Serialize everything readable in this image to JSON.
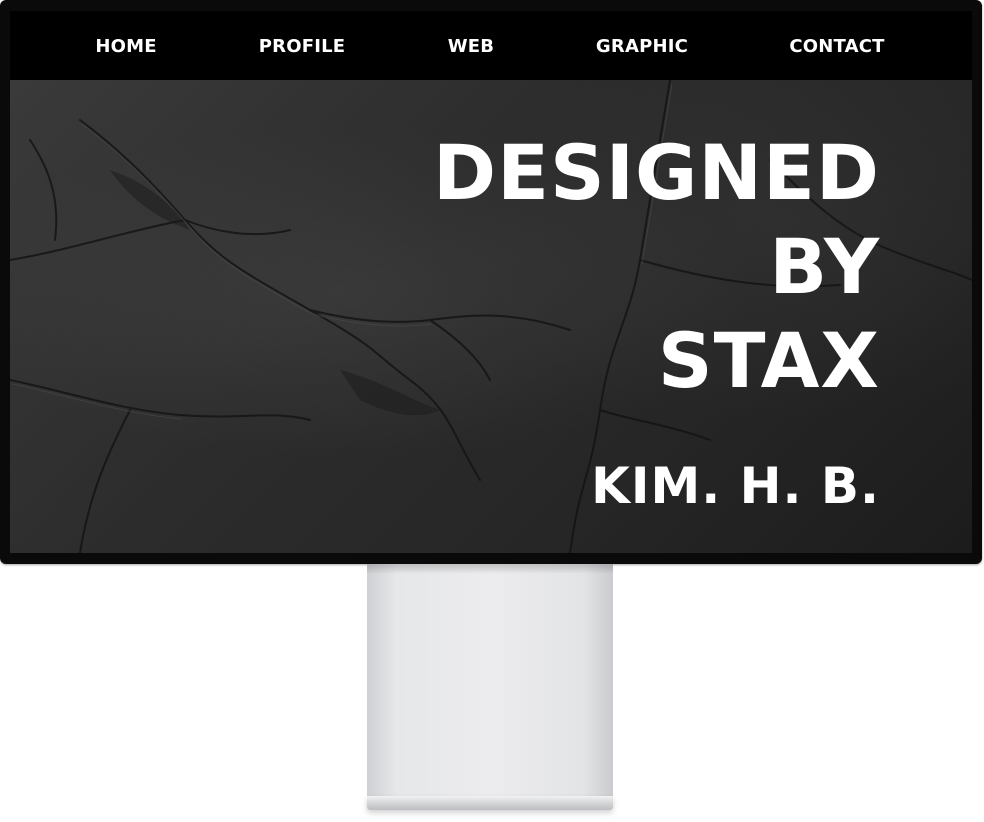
{
  "nav": {
    "items": [
      {
        "label": "HOME"
      },
      {
        "label": "PROFILE"
      },
      {
        "label": "WEB"
      },
      {
        "label": "GRAPHIC"
      },
      {
        "label": "CONTACT"
      }
    ]
  },
  "hero": {
    "title_lines": [
      "DESIGNED",
      "BY",
      "STAX"
    ],
    "author": "KIM. H. B."
  },
  "colors": {
    "nav_background": "#000000",
    "text": "#ffffff",
    "hero_texture": "#2c2c2c",
    "monitor_bezel": "#0a0a0a",
    "stand": "#e6e7e9"
  }
}
